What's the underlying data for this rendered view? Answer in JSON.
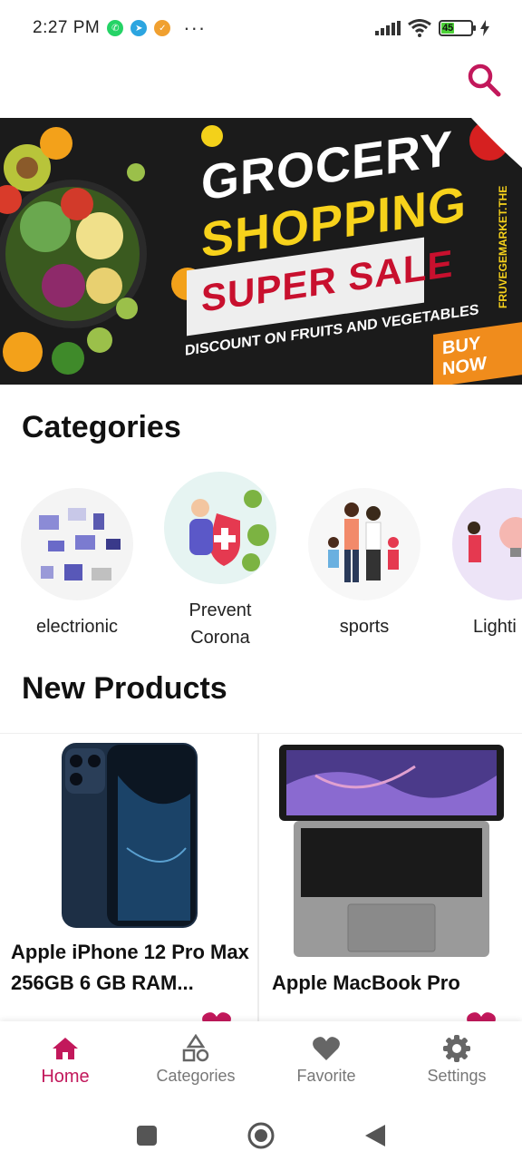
{
  "status_bar": {
    "time": "2:27 PM",
    "battery": "45",
    "battery_level": 0.45,
    "icons": [
      "whatsapp-icon",
      "telegram-icon",
      "notification-icon",
      "more-icon",
      "signal-icon",
      "wifi-icon",
      "battery-icon",
      "charging-icon"
    ]
  },
  "app_bar": {
    "search_icon": "search-icon"
  },
  "banner": {
    "title_line1": "GROCERY",
    "title_line2": "SHOPPING",
    "sale": "SUPER SALE",
    "subtitle": "DISCOUNT ON FRUITS AND VEGETABLES",
    "cta": "BUY NOW",
    "vertical_text": "FRUVEGEMARKET.THE"
  },
  "categories": {
    "title": "Categories",
    "items": [
      {
        "label": "electrionic"
      },
      {
        "label": "Prevent Corona"
      },
      {
        "label": "sports"
      },
      {
        "label": "Lighti"
      }
    ]
  },
  "new_products": {
    "title": "New Products",
    "items": [
      {
        "name": "Apple iPhone 12 Pro Max 256GB 6 GB RAM..."
      },
      {
        "name": "Apple MacBook Pro"
      }
    ]
  },
  "bottom_nav": {
    "items": [
      {
        "label": "Home",
        "icon": "home-icon",
        "active": true
      },
      {
        "label": "Categories",
        "icon": "shapes-icon",
        "active": false
      },
      {
        "label": "Favorite",
        "icon": "heart-icon",
        "active": false
      },
      {
        "label": "Settings",
        "icon": "gear-icon",
        "active": false
      }
    ]
  },
  "colors": {
    "accent": "#c2185b",
    "banner_bg": "#1b1b1b",
    "banner_yellow": "#f7d21b",
    "banner_red": "#c8102e",
    "nav_inactive": "#777777"
  }
}
